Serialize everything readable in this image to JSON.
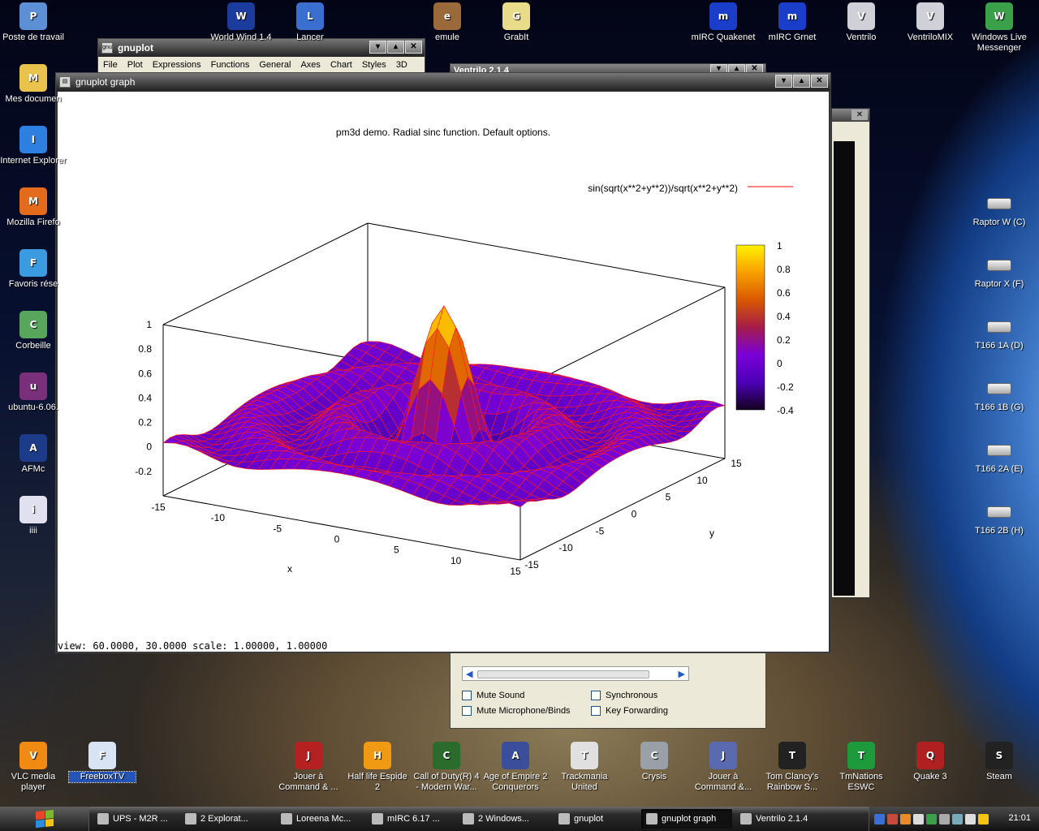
{
  "desktop_left": [
    {
      "label": "Poste de travail",
      "icon": "computer-icon",
      "color": "#5c8fd6"
    },
    {
      "label": "Mes documen",
      "icon": "folder-icon",
      "color": "#e9c34b"
    },
    {
      "label": "Internet Explorer",
      "icon": "ie-icon",
      "color": "#2d7fe0"
    },
    {
      "label": "Mozilla Firefo",
      "icon": "firefox-icon",
      "color": "#e46b1c"
    },
    {
      "label": "Favoris rése",
      "icon": "network-icon",
      "color": "#3a9be0"
    },
    {
      "label": "Corbeille",
      "icon": "recycle-bin-icon",
      "color": "#58a55c"
    },
    {
      "label": "ubuntu-6.06.",
      "icon": "winrar-icon",
      "color": "#7a2f7a"
    },
    {
      "label": "AFMc",
      "icon": "dev-c-icon",
      "color": "#1c3c8a"
    },
    {
      "label": "iiii",
      "icon": "document-icon",
      "color": "#e0e0f0"
    }
  ],
  "desktop_top": [
    {
      "label": "World Wind 1.4",
      "icon": "nasa-icon",
      "color": "#1b3c9c"
    },
    {
      "label": "Lancer",
      "icon": "google-earth-icon",
      "color": "#3b6fcf"
    },
    {
      "label": "emule",
      "icon": "emule-icon",
      "color": "#9a6a3a"
    },
    {
      "label": "GrabIt",
      "icon": "grabit-icon",
      "color": "#e8dc8a"
    },
    {
      "label": "mIRC Quakenet",
      "icon": "mirc-icon",
      "color": "#1a3ec9"
    },
    {
      "label": "mIRC Grnet",
      "icon": "mirc-icon",
      "color": "#1a3ec9"
    },
    {
      "label": "Ventrilo",
      "icon": "ventrilo-icon",
      "color": "#d0d0d8"
    },
    {
      "label": "VentriloMIX",
      "icon": "ventrilo-icon",
      "color": "#d0d0d8"
    },
    {
      "label": "Windows Live Messenger",
      "icon": "messenger-icon",
      "color": "#3aa04a"
    }
  ],
  "desktop_right": [
    {
      "label": "Raptor W (C)",
      "icon": "drive-icon"
    },
    {
      "label": "Raptor X (F)",
      "icon": "drive-icon"
    },
    {
      "label": "T166 1A (D)",
      "icon": "drive-icon"
    },
    {
      "label": "T166 1B (G)",
      "icon": "drive-icon"
    },
    {
      "label": "T166 2A (E)",
      "icon": "drive-icon"
    },
    {
      "label": "T166 2B (H)",
      "icon": "drive-icon"
    }
  ],
  "desktop_bottom": [
    {
      "label": "VLC media player",
      "icon": "vlc-icon",
      "color": "#f08a12"
    },
    {
      "label": "FreeboxTV",
      "icon": "document-icon",
      "color": "#d8e4f4",
      "selected": true
    },
    {
      "label": "Jouer à Command & ...",
      "icon": "cnc-icon",
      "color": "#b52020"
    },
    {
      "label": "Half life Espide 2",
      "icon": "half-life-icon",
      "color": "#f09a14"
    },
    {
      "label": "Call of Duty(R) 4 - Modern War...",
      "icon": "cod4-icon",
      "color": "#2b6b2b"
    },
    {
      "label": "Age of Empire 2 Conquerors",
      "icon": "aoe-icon",
      "color": "#3a4e9c"
    },
    {
      "label": "Trackmania United",
      "icon": "trackmania-icon",
      "color": "#e0e0e0"
    },
    {
      "label": "Crysis",
      "icon": "crysis-icon",
      "color": "#9aa0a8"
    },
    {
      "label": "Jouer à Command &...",
      "icon": "cnc3-icon",
      "color": "#5a6ab0"
    },
    {
      "label": "Tom Clancy's Rainbow S...",
      "icon": "rainbow-six-icon",
      "color": "#222"
    },
    {
      "label": "TmNations ESWC",
      "icon": "tmnations-icon",
      "color": "#1c9a3c"
    },
    {
      "label": "Quake 3",
      "icon": "quake-icon",
      "color": "#b02020"
    },
    {
      "label": "Steam",
      "icon": "steam-icon",
      "color": "#222"
    }
  ],
  "gnuplot_window": {
    "title": "gnuplot",
    "menu": [
      "File",
      "Plot",
      "Expressions",
      "Functions",
      "General",
      "Axes",
      "Chart",
      "Styles",
      "3D"
    ]
  },
  "ventrilo_window": {
    "title": "Ventrilo 2.1.4",
    "checkboxes": [
      "Mute Sound",
      "Synchronous",
      "Mute Microphone/Binds",
      "Key Forwarding"
    ]
  },
  "graph_window": {
    "title": "gnuplot graph",
    "status": "view:  60.0000,  30.0000   scale:  1.00000,  1.00000"
  },
  "chart_data": {
    "type": "surface",
    "title": "pm3d demo. Radial sinc function. Default options.",
    "legend": "sin(sqrt(x**2+y**2))/sqrt(x**2+y**2)",
    "legend_color": "#ff0000",
    "xlabel": "x",
    "ylabel": "y",
    "xticks": [
      "-15",
      "-10",
      "-5",
      "0",
      "5",
      "10",
      "15"
    ],
    "yticks": [
      "-15",
      "-10",
      "-5",
      "0",
      "5",
      "10",
      "15"
    ],
    "zticks": [
      "1",
      "0.8",
      "0.6",
      "0.4",
      "0.2",
      "0",
      "-0.2"
    ],
    "colorbar_ticks": [
      "1",
      "0.8",
      "0.6",
      "0.4",
      "0.2",
      "0",
      "-0.2",
      "-0.4"
    ],
    "colorbar_stops": [
      "#fff200",
      "#f9a000",
      "#d85800",
      "#a51c4a",
      "#7a00d8",
      "#4b00b6",
      "#140020"
    ],
    "xrange": [
      -15,
      15
    ],
    "yrange": [
      -15,
      15
    ],
    "zrange": [
      -0.4,
      1
    ],
    "view": [
      60,
      30
    ]
  },
  "taskbar": {
    "items": [
      {
        "label": "UPS - M2R ...",
        "icon": "firefox-icon"
      },
      {
        "label": "2 Explorat...",
        "icon": "folder-icon"
      },
      {
        "label": "Loreena Mc...",
        "icon": "media-icon"
      },
      {
        "label": "mIRC 6.17 ...",
        "icon": "mirc-icon"
      },
      {
        "label": "2 Windows...",
        "icon": "messenger-icon"
      },
      {
        "label": "gnuplot",
        "icon": "gnuplot-icon"
      },
      {
        "label": "gnuplot graph",
        "icon": "gnuplot-icon",
        "active": true
      },
      {
        "label": "Ventrilo 2.1.4",
        "icon": "ventrilo-icon"
      }
    ],
    "clock": "21:01"
  }
}
